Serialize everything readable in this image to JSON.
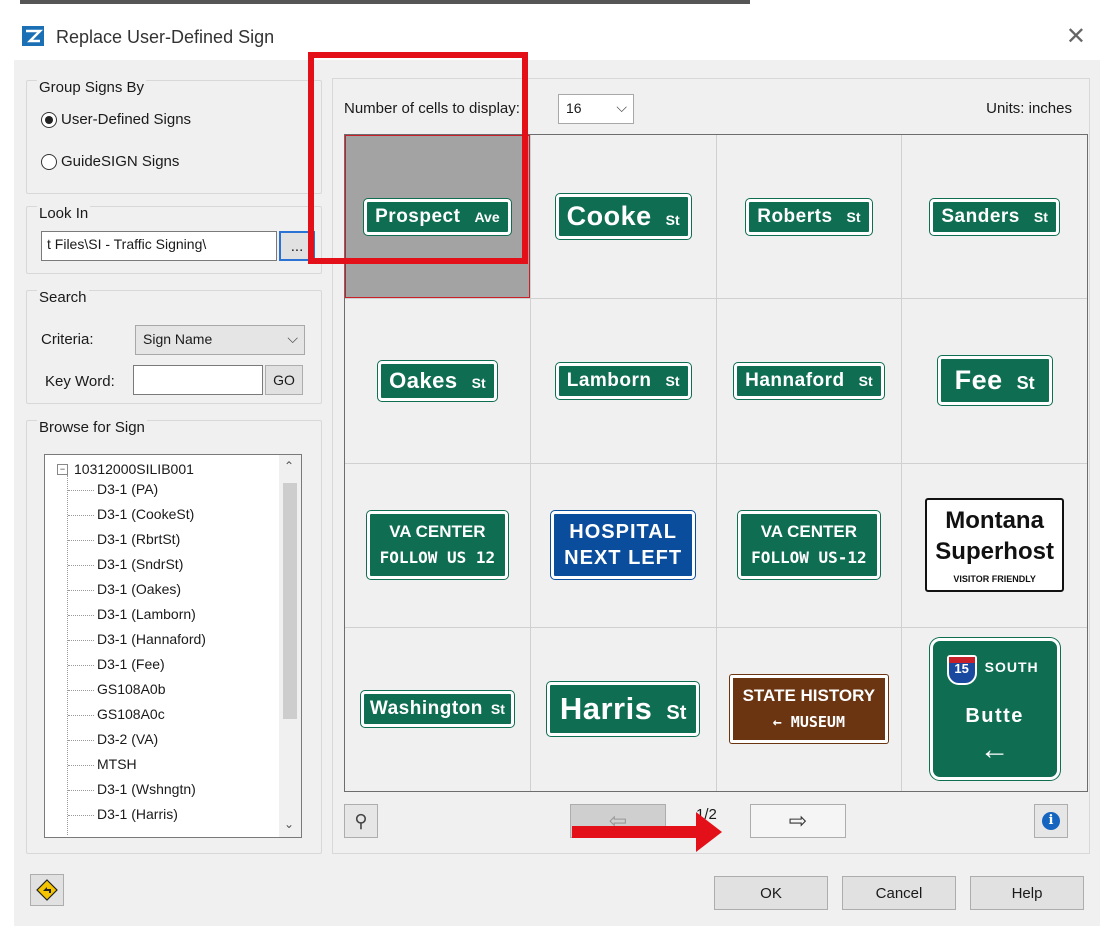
{
  "window": {
    "title": "Replace User-Defined Sign",
    "close_glyph": "✕"
  },
  "group_by": {
    "label": "Group Signs By",
    "options": [
      {
        "label": "User-Defined Signs",
        "selected": true
      },
      {
        "label": "GuideSIGN Signs",
        "selected": false
      }
    ]
  },
  "look_in": {
    "label": "Look In",
    "path": "t Files\\SI - Traffic Signing\\",
    "browse_label": "..."
  },
  "search": {
    "label": "Search",
    "criteria_label": "Criteria:",
    "criteria_value": "Sign Name",
    "keyword_label": "Key Word:",
    "keyword_value": "",
    "go_label": "GO"
  },
  "browse": {
    "label": "Browse for Sign",
    "root": "10312000SILIB001",
    "items": [
      "D3-1 (PA)",
      "D3-1 (CookeSt)",
      "D3-1 (RbrtSt)",
      "D3-1 (SndrSt)",
      "D3-1 (Oakes)",
      "D3-1 (Lamborn)",
      "D3-1 (Hannaford)",
      "D3-1 (Fee)",
      "GS108A0b",
      "GS108A0c",
      "D3-2 (VA)",
      "MTSH",
      "D3-1 (Wshngtn)",
      "D3-1 (Harris)"
    ]
  },
  "display": {
    "cells_label": "Number of cells to display:",
    "cells_value": "16",
    "units_label": "Units: inches"
  },
  "signs": {
    "s1": {
      "main": "Prospect",
      "suffix": "Ave"
    },
    "s2": {
      "main": "Cooke",
      "suffix": "St"
    },
    "s3": {
      "main": "Roberts",
      "suffix": "St"
    },
    "s4": {
      "main": "Sanders",
      "suffix": "St"
    },
    "s5": {
      "main": "Oakes",
      "suffix": "St"
    },
    "s6": {
      "main": "Lamborn",
      "suffix": "St"
    },
    "s7": {
      "main": "Hannaford",
      "suffix": "St"
    },
    "s8": {
      "main": "Fee",
      "suffix": "St"
    },
    "s9": {
      "line1": "VA CENTER",
      "line2": "FOLLOW US 12"
    },
    "s10": {
      "line1": "HOSPITAL",
      "line2": "NEXT LEFT"
    },
    "s11": {
      "line1": "VA CENTER",
      "line2": "FOLLOW US-12"
    },
    "s12": {
      "line1": "Montana",
      "line2": "Superhost",
      "line3": "VISITOR FRIENDLY"
    },
    "s13": {
      "main": "Washington",
      "suffix": "St"
    },
    "s14": {
      "main": "Harris",
      "suffix": "St"
    },
    "s15": {
      "line1": "STATE HISTORY",
      "line2": "← MUSEUM"
    },
    "s16": {
      "shield": "15",
      "direction": "SOUTH",
      "city": "Butte",
      "arrow": "←"
    }
  },
  "pager": {
    "page": "1/2",
    "prev_glyph": "⇦",
    "next_glyph": "⇨",
    "zoom_glyph": "⚲",
    "info_glyph": "i"
  },
  "footer": {
    "ok_label": "OK",
    "cancel_label": "Cancel",
    "help_label": "Help"
  },
  "colors": {
    "sign_green": "#0f6d52",
    "sign_blue": "#0a4d9c",
    "sign_brown": "#6b3512",
    "annotation_red": "#e3101a"
  }
}
